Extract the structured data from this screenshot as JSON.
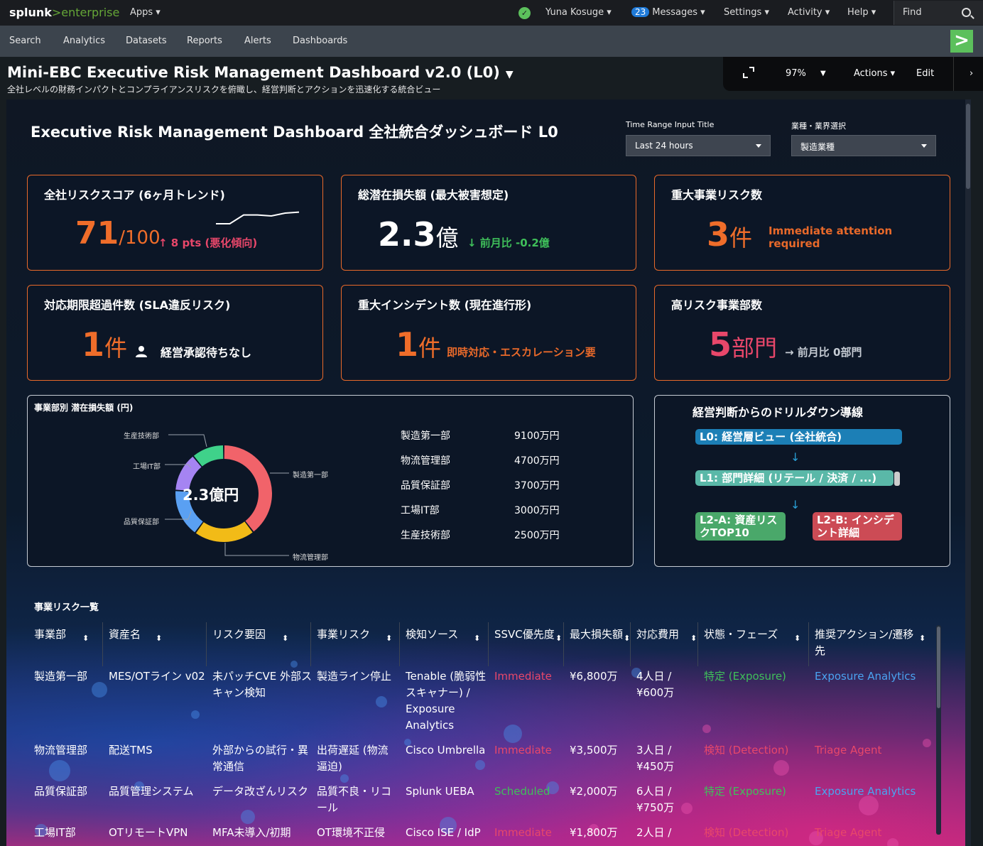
{
  "topbar": {
    "logo_main": "splunk",
    "logo_sep": ">",
    "logo_product": "enterprise",
    "apps": "Apps ▾",
    "user": "Yuna Kosuge ▾",
    "messages_count": "23",
    "messages": "Messages ▾",
    "settings": "Settings ▾",
    "activity": "Activity ▾",
    "help": "Help ▾",
    "find": "Find"
  },
  "nav": {
    "items": [
      "Search",
      "Analytics",
      "Datasets",
      "Reports",
      "Alerts",
      "Dashboards"
    ]
  },
  "header": {
    "title": "Mini-EBC Executive Risk Management Dashboard v2.0 (L0)",
    "subtitle": "全社レベルの財務インパクトとコンプライアンスリスクを俯瞰し、経営判断とアクションを迅速化する統合ビュー",
    "zoom": "97%",
    "actions": "Actions ▾",
    "edit": "Edit"
  },
  "dashboard": {
    "heading": "Executive Risk Management Dashboard 全社統合ダッシュボード L0",
    "time_label": "Time Range Input Title",
    "time_value": "Last 24 hours",
    "industry_label": "業種・業界選択",
    "industry_value": "製造業種"
  },
  "kpis": {
    "risk_score": {
      "title": "全社リスクスコア (6ヶ月トレンド)",
      "value": "71",
      "unit": "/100",
      "delta": "↑ 8 pts (悪化傾向)",
      "trend": [
        0.0,
        0.0,
        0.62,
        0.62,
        0.55,
        0.75,
        0.82
      ]
    },
    "loss": {
      "title": "総潜在損失額 (最大被害想定)",
      "value": "2.3",
      "unit": "億",
      "delta": "↓ 前月比 -0.2億"
    },
    "major_risk": {
      "title": "重大事業リスク数",
      "value": "3",
      "unit": "件",
      "note1": "Immediate attention",
      "note2": "required"
    },
    "sla": {
      "title": "対応期限超過件数 (SLA違反リスク)",
      "value": "1",
      "unit": "件",
      "note": "経営承認待ちなし"
    },
    "incident": {
      "title": "重大インシデント数 (現在進行形)",
      "value": "1",
      "unit": "件",
      "note": "即時対応・エスカレーション要"
    },
    "high_risk_dept": {
      "title": "高リスク事業部数",
      "value": "5",
      "unit": "部門",
      "note": "→ 前月比 0部門"
    }
  },
  "loss_by_dept": {
    "title": "事業部別 潜在損失額 (円)",
    "center": "2.3億円",
    "items": [
      {
        "name": "製造第一部",
        "value": "9100万円"
      },
      {
        "name": "物流管理部",
        "value": "4700万円"
      },
      {
        "name": "品質保証部",
        "value": "3700万円"
      },
      {
        "name": "工場IT部",
        "value": "3000万円"
      },
      {
        "name": "生産技術部",
        "value": "2500万円"
      }
    ]
  },
  "drilldown": {
    "title": "経営判断からのドリルダウン導線",
    "l0": "L0: 経営層ビュー (全社統合)",
    "l1": "L1: 部門詳細 (リテール / 決済 / ...)",
    "l2a": "L2-A: 資産リスクTOP10",
    "l2b": "L2-B: インシデント詳細"
  },
  "table": {
    "title": "事業リスク一覧",
    "headers": [
      "事業部",
      "資産名",
      "リスク要因",
      "事業リスク",
      "検知ソース",
      "SSVC優先度",
      "最大損失額",
      "対応費用",
      "状態・フェーズ",
      "推奨アクション/遷移先"
    ],
    "rows": [
      [
        "製造第一部",
        "MES/OTライン v02",
        "未パッチCVE 外部スキャン検知",
        "製造ライン停止",
        "Tenable (脆弱性スキャナー) / Exposure Analytics",
        "Immediate",
        "¥6,800万",
        "4人日 / ¥600万",
        "特定 (Exposure)",
        "Exposure Analytics"
      ],
      [
        "物流管理部",
        "配送TMS",
        "外部からの試行・異常通信",
        "出荷遅延 (物流逼迫)",
        "Cisco Umbrella",
        "Immediate",
        "¥3,500万",
        "3人日 / ¥450万",
        "検知 (Detection)",
        "Triage Agent"
      ],
      [
        "品質保証部",
        "品質管理システム",
        "データ改ざんリスク",
        "品質不良・リコール",
        "Splunk UEBA",
        "Scheduled",
        "¥2,000万",
        "6人日 / ¥750万",
        "特定 (Exposure)",
        "Exposure Analytics"
      ],
      [
        "工場IT部",
        "OTリモートVPN",
        "MFA未導入/初期",
        "OT環境不正侵",
        "Cisco ISE / IdP",
        "Immediate",
        "¥1,800万",
        "2人日 /",
        "検知 (Detection)",
        "Triage Agent"
      ]
    ]
  },
  "colors": {
    "accent": "#e8692a",
    "red": "#e8476a",
    "green": "#3fbf5a",
    "blue": "#4aa3f0",
    "splunk_green": "#65a637"
  }
}
